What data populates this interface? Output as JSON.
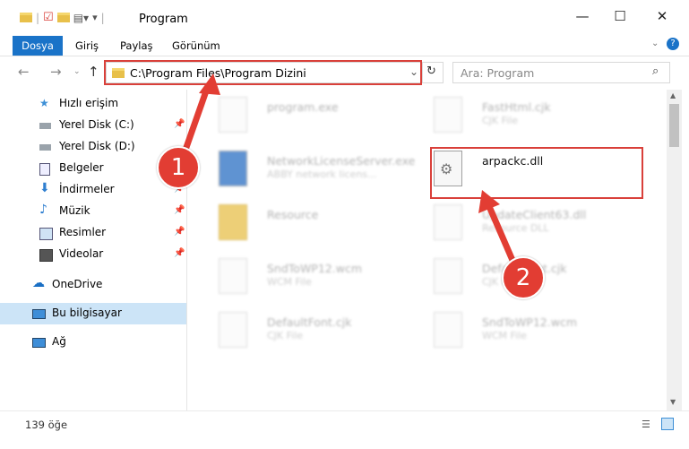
{
  "window": {
    "title": "Program"
  },
  "ribbon": {
    "tabs": [
      "Dosya",
      "Giriş",
      "Paylaş",
      "Görünüm"
    ]
  },
  "address": {
    "path": "C:\\Program Files\\Program Dizini"
  },
  "search": {
    "placeholder": "Ara: Program"
  },
  "sidebar": {
    "items": [
      {
        "label": "Hızlı erişim",
        "icon": "star-icon",
        "pinned": false
      },
      {
        "label": "Yerel Disk (C:)",
        "icon": "drive-icon",
        "pinned": true
      },
      {
        "label": "Yerel Disk (D:)",
        "icon": "drive-icon",
        "pinned": false
      },
      {
        "label": "Belgeler",
        "icon": "document-icon",
        "pinned": false
      },
      {
        "label": "İndirmeler",
        "icon": "download-icon",
        "pinned": true
      },
      {
        "label": "Müzik",
        "icon": "music-icon",
        "pinned": true
      },
      {
        "label": "Resimler",
        "icon": "picture-icon",
        "pinned": true
      },
      {
        "label": "Videolar",
        "icon": "video-icon",
        "pinned": true
      },
      {
        "label": "OneDrive",
        "icon": "cloud-icon",
        "pinned": false
      },
      {
        "label": "Bu bilgisayar",
        "icon": "computer-icon",
        "pinned": false,
        "selected": true
      },
      {
        "label": "Ağ",
        "icon": "network-icon",
        "pinned": false
      }
    ]
  },
  "files": [
    {
      "name": "program.exe",
      "sub": ""
    },
    {
      "name": "FastHtml.cjk",
      "sub": "CJK File"
    },
    {
      "name": "NetworkLicenseServer.exe",
      "sub": "ABBY network licens..."
    },
    {
      "name": "arpackc.dll",
      "sub": ""
    },
    {
      "name": "Resource",
      "sub": ""
    },
    {
      "name": "UpdateClient63.dll",
      "sub": "Resource DLL"
    },
    {
      "name": "SndToWP12.wcm",
      "sub": "WCM File"
    },
    {
      "name": "DefaultFont.cjk",
      "sub": "CJK File"
    },
    {
      "name": "DefaultFont.cjk",
      "sub": "CJK File"
    },
    {
      "name": "SndToWP12.wcm",
      "sub": "WCM File"
    }
  ],
  "annotations": {
    "step1": "1",
    "step2": "2"
  },
  "status": {
    "count": "139 öğe"
  },
  "colors": {
    "accent": "#1a73c8",
    "highlight": "#d9403a",
    "arrow": "#e23d33"
  }
}
